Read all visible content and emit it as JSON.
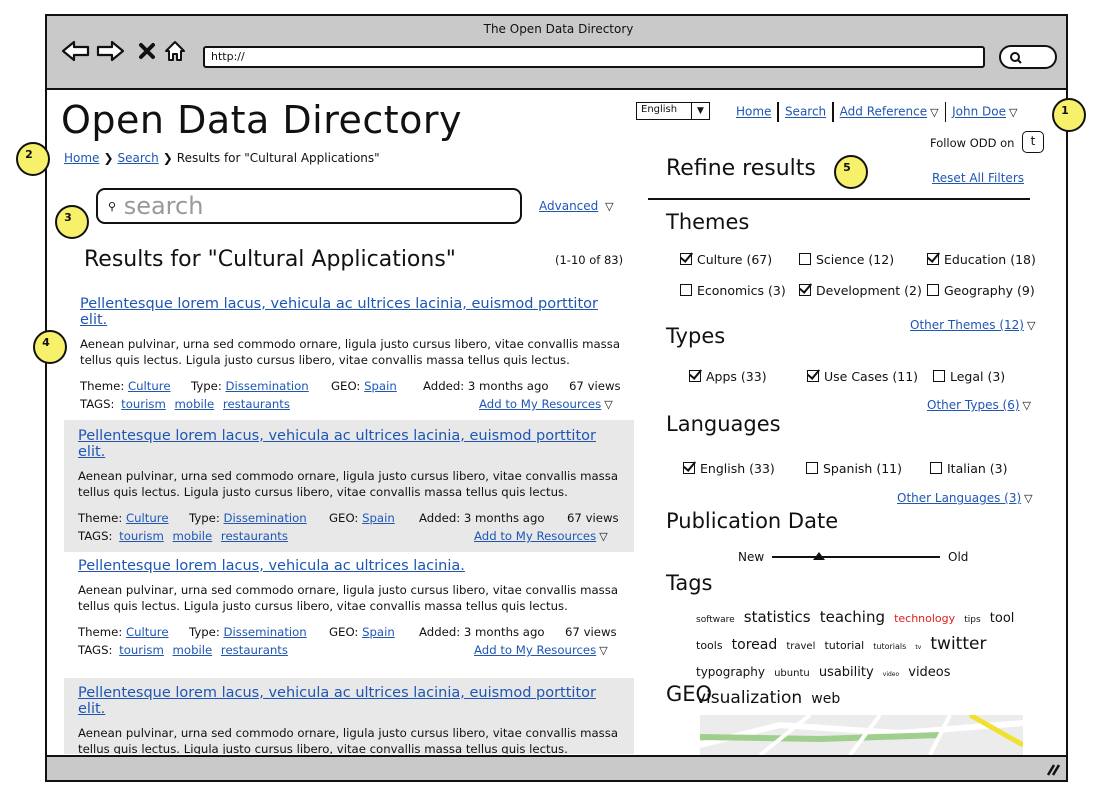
{
  "browser": {
    "window_title": "The Open Data Directory",
    "url": "http://"
  },
  "site": {
    "title": "Open Data Directory",
    "language": "English",
    "nav": {
      "home": "Home",
      "search": "Search",
      "add_reference": "Add Reference",
      "user": "John Doe"
    },
    "follow_text": "Follow ODD on"
  },
  "breadcrumb": {
    "home": "Home",
    "search": "Search",
    "current": "Results for \"Cultural Applications\""
  },
  "search": {
    "placeholder": "search",
    "advanced_label": "Advanced"
  },
  "results": {
    "heading": "Results for \"Cultural Applications\"",
    "count": "(1-10 of 83)",
    "items": [
      {
        "title": "Pellentesque lorem lacus, vehicula ac ultrices lacinia, euismod porttitor elit.",
        "body": "Aenean pulvinar, urna sed commodo ornare, ligula justo cursus libero, vitae convallis massa tellus quis lectus. Ligula justo cursus libero, vitae convallis massa tellus quis lectus.",
        "theme_label": "Theme:",
        "theme": "Culture",
        "type_label": "Type:",
        "type": "Dissemination",
        "geo_label": "GEO:",
        "geo": "Spain",
        "added": "Added: 3 months ago",
        "views": "67 views",
        "tags_label": "TAGS:",
        "tags": [
          "tourism",
          "mobile",
          "restaurants"
        ],
        "add_label": "Add to My Resources"
      },
      {
        "title": "Pellentesque lorem lacus, vehicula ac ultrices lacinia, euismod porttitor elit.",
        "body": "Aenean pulvinar, urna sed commodo ornare, ligula justo cursus libero, vitae convallis massa tellus quis lectus. Ligula justo cursus libero, vitae convallis massa tellus quis lectus.",
        "theme_label": "Theme:",
        "theme": "Culture",
        "type_label": "Type:",
        "type": "Dissemination",
        "geo_label": "GEO:",
        "geo": "Spain",
        "added": "Added: 3 months ago",
        "views": "67 views",
        "tags_label": "TAGS:",
        "tags": [
          "tourism",
          "mobile",
          "restaurants"
        ],
        "add_label": "Add to My Resources"
      },
      {
        "title": "Pellentesque lorem lacus, vehicula ac ultrices lacinia.",
        "body": "Aenean pulvinar, urna sed commodo ornare, ligula justo cursus libero, vitae convallis massa tellus quis lectus. Ligula justo cursus libero, vitae convallis massa tellus quis lectus.",
        "theme_label": "Theme:",
        "theme": "Culture",
        "type_label": "Type:",
        "type": "Dissemination",
        "geo_label": "GEO:",
        "geo": "Spain",
        "added": "Added: 3 months ago",
        "views": "67 views",
        "tags_label": "TAGS:",
        "tags": [
          "tourism",
          "mobile",
          "restaurants"
        ],
        "add_label": "Add to My Resources"
      },
      {
        "title": "Pellentesque lorem lacus, vehicula ac ultrices lacinia, euismod porttitor elit.",
        "body": "Aenean pulvinar, urna sed commodo ornare, ligula justo cursus libero, vitae convallis massa tellus quis lectus. Ligula justo cursus libero, vitae convallis massa tellus quis lectus."
      }
    ]
  },
  "refine": {
    "title": "Refine results",
    "reset": "Reset All Filters",
    "themes": {
      "heading": "Themes",
      "items": [
        {
          "label": "Culture (67)",
          "checked": true
        },
        {
          "label": "Science (12)",
          "checked": false
        },
        {
          "label": "Education (18)",
          "checked": true
        },
        {
          "label": "Economics (3)",
          "checked": false
        },
        {
          "label": "Development (2)",
          "checked": true
        },
        {
          "label": "Geography (9)",
          "checked": false
        }
      ],
      "more": "Other Themes (12)"
    },
    "types": {
      "heading": "Types",
      "items": [
        {
          "label": "Apps (33)",
          "checked": true
        },
        {
          "label": "Use Cases (11)",
          "checked": true
        },
        {
          "label": "Legal (3)",
          "checked": false
        }
      ],
      "more": "Other Types (6)"
    },
    "languages": {
      "heading": "Languages",
      "items": [
        {
          "label": "English (33)",
          "checked": true
        },
        {
          "label": "Spanish (11)",
          "checked": false
        },
        {
          "label": "Italian (3)",
          "checked": false
        }
      ],
      "more": "Other Languages (3)"
    },
    "publication": {
      "heading": "Publication Date",
      "new_label": "New",
      "old_label": "Old",
      "slider_value": 0.28
    },
    "tags": {
      "heading": "Tags",
      "cloud": [
        {
          "text": "software",
          "size": 9
        },
        {
          "text": "statistics",
          "size": 15
        },
        {
          "text": "teaching",
          "size": 15
        },
        {
          "text": "technology",
          "size": 11,
          "color": "#e0201a"
        },
        {
          "text": "tips",
          "size": 9
        },
        {
          "text": "tool",
          "size": 13
        },
        {
          "text": "tools",
          "size": 11
        },
        {
          "text": "toread",
          "size": 14
        },
        {
          "text": "travel",
          "size": 10
        },
        {
          "text": "tutorial",
          "size": 11
        },
        {
          "text": "tutorials",
          "size": 8
        },
        {
          "text": "tv",
          "size": 6
        },
        {
          "text": "twitter",
          "size": 17
        },
        {
          "text": "typography",
          "size": 12
        },
        {
          "text": "ubuntu",
          "size": 10
        },
        {
          "text": "usability",
          "size": 13
        },
        {
          "text": "video",
          "size": 6
        },
        {
          "text": "videos",
          "size": 13
        },
        {
          "text": "visualization",
          "size": 17
        },
        {
          "text": "web",
          "size": 14
        }
      ]
    },
    "geo": {
      "heading": "GEO"
    }
  },
  "callouts": [
    "1",
    "2",
    "3",
    "4",
    "5"
  ],
  "colors": {
    "link": "#1f56b3",
    "callout": "#f6f06a",
    "chrome": "#c9c9c9",
    "shaded_result": "#e8e8e8"
  }
}
